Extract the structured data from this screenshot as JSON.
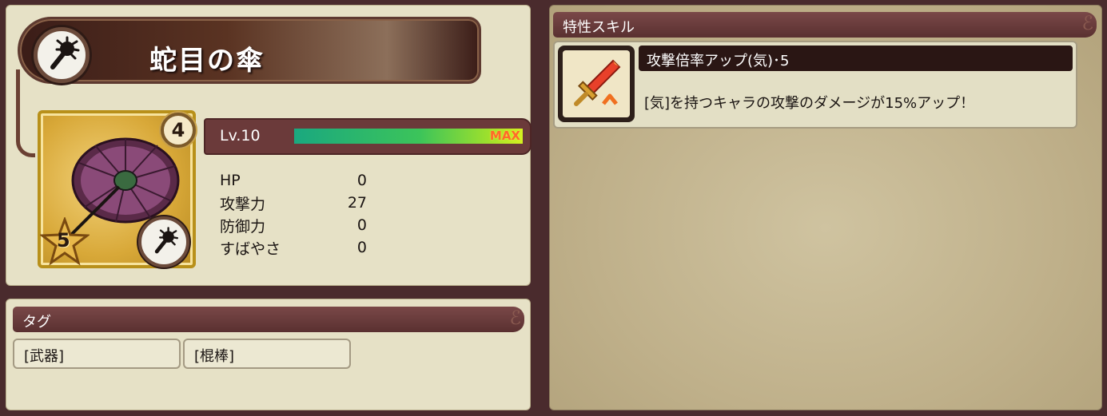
{
  "item": {
    "name": "蛇目の傘",
    "type_icon": "mace-icon",
    "rarity_badge": "4",
    "stars": "5"
  },
  "level": {
    "label": "Lv.10",
    "max_label": "MAX",
    "progress": 1.0
  },
  "stats": [
    {
      "name": "HP",
      "value": "0"
    },
    {
      "name": "攻撃力",
      "value": "27"
    },
    {
      "name": "防御力",
      "value": "0"
    },
    {
      "name": "すばやさ",
      "value": "0"
    }
  ],
  "tags": {
    "header": "タグ",
    "items": [
      "[武器]",
      "[棍棒]"
    ]
  },
  "skills": {
    "header": "特性スキル",
    "items": [
      {
        "name": "攻撃倍率アップ(気)･5",
        "description": "[気]を持つキャラの攻撃のダメージが15%アップ！",
        "icon": "sword-attack-up-icon"
      }
    ]
  },
  "colors": {
    "panel_bg": "#e6e1c6",
    "header_bg": "#6b3a3a",
    "frame_bg": "#4a2b2d",
    "level_fill_start": "#1aa87f",
    "level_fill_end": "#d5f020",
    "max_color": "#ff6a2a"
  }
}
